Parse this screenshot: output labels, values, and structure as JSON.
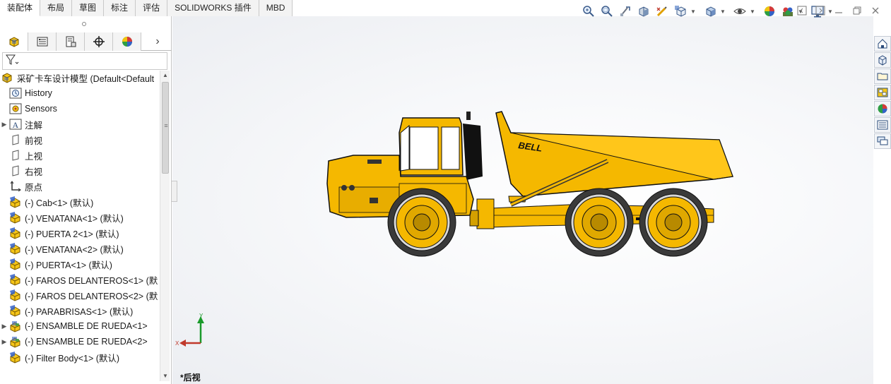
{
  "command_tabs": [
    {
      "label": "装配体",
      "active": true
    },
    {
      "label": "布局",
      "active": false
    },
    {
      "label": "草图",
      "active": false
    },
    {
      "label": "标注",
      "active": false
    },
    {
      "label": "评估",
      "active": false
    },
    {
      "label": "SOLIDWORKS 插件",
      "active": false
    },
    {
      "label": "MBD",
      "active": false
    }
  ],
  "feature_tree": {
    "root_label": "采矿卡车设计模型  (Default<Default",
    "items": [
      {
        "label": "History",
        "icon": "history-icon",
        "expandable": false
      },
      {
        "label": "Sensors",
        "icon": "sensors-icon",
        "expandable": false
      },
      {
        "label": "注解",
        "icon": "annotations-icon",
        "expandable": true
      },
      {
        "label": "前视",
        "icon": "plane-icon",
        "expandable": false
      },
      {
        "label": "上视",
        "icon": "plane-icon",
        "expandable": false
      },
      {
        "label": "右视",
        "icon": "plane-icon",
        "expandable": false
      },
      {
        "label": "原点",
        "icon": "origin-icon",
        "expandable": false
      },
      {
        "label": "(-) Cab<1> (默认)",
        "icon": "part-icon",
        "expandable": false
      },
      {
        "label": "(-) VENATANA<1> (默认)",
        "icon": "part-icon",
        "expandable": false
      },
      {
        "label": "(-) PUERTA 2<1> (默认)",
        "icon": "part-icon",
        "expandable": false
      },
      {
        "label": "(-) VENATANA<2> (默认)",
        "icon": "part-icon",
        "expandable": false
      },
      {
        "label": "(-) PUERTA<1> (默认)",
        "icon": "part-icon",
        "expandable": false
      },
      {
        "label": "(-) FAROS DELANTEROS<1> (默",
        "icon": "part-icon",
        "expandable": false
      },
      {
        "label": "(-) FAROS DELANTEROS<2> (默",
        "icon": "part-icon",
        "expandable": false
      },
      {
        "label": "(-) PARABRISAS<1> (默认)",
        "icon": "part-icon",
        "expandable": false
      },
      {
        "label": "(-) ENSAMBLE DE RUEDA<1>",
        "icon": "subassembly-icon",
        "expandable": true
      },
      {
        "label": "(-) ENSAMBLE DE RUEDA<2>",
        "icon": "subassembly-icon",
        "expandable": true
      },
      {
        "label": "(-) Filter Body<1> (默认)",
        "icon": "part-icon",
        "expandable": false
      }
    ]
  },
  "viewport": {
    "view_name": "*后视",
    "triad": {
      "x_label": "X",
      "y_label": "Y"
    },
    "model_brand": "BELL"
  },
  "colors": {
    "truck_body": "#f5b800",
    "truck_shadow": "#c89000",
    "tire": "#3a3a3a"
  }
}
